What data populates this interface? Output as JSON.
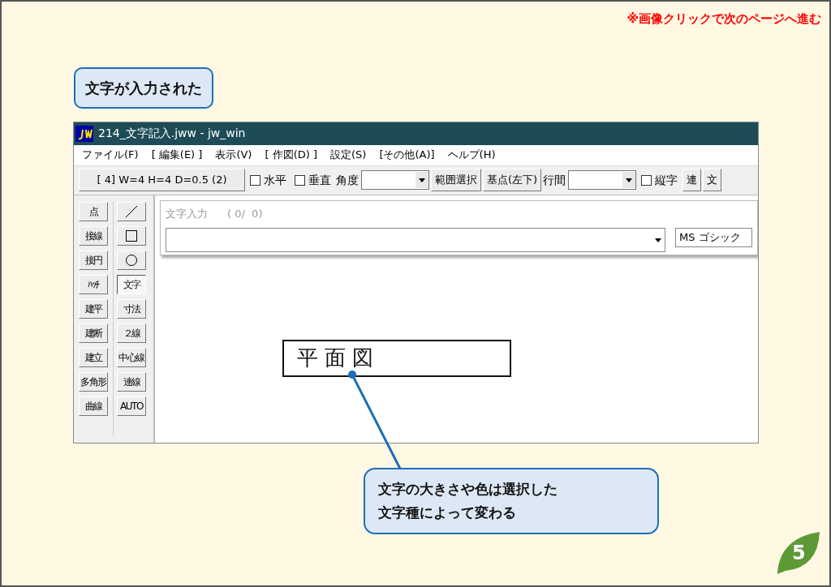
{
  "slide": {
    "notice": "※画像クリックで次のページへ進む",
    "heading": "文字が入力された",
    "page_number": "5"
  },
  "window": {
    "title": "214_文字記入.jww - jw_win"
  },
  "menu": [
    "ファイル(F)",
    "[ 編集(E) ]",
    "表示(V)",
    "[ 作図(D) ]",
    "設定(S)",
    "[その他(A)]",
    "ヘルプ(H)"
  ],
  "toolbar": [
    {
      "kind": "button",
      "label": "[ 4]  W=4  H=4  D=0.5 (2)"
    },
    {
      "kind": "checkbox",
      "label": "水平",
      "checked": false
    },
    {
      "kind": "checkbox",
      "label": "垂直",
      "checked": false
    },
    {
      "kind": "combo",
      "label": "角度"
    },
    {
      "kind": "button",
      "label": "範囲選択"
    },
    {
      "kind": "button",
      "label": "基点(左下)"
    },
    {
      "kind": "combo",
      "label": "行間"
    },
    {
      "kind": "checkbox",
      "label": "縦字",
      "checked": false
    },
    {
      "kind": "button",
      "label": "連"
    },
    {
      "kind": "button",
      "label": "文"
    }
  ],
  "tools_left": [
    {
      "label": "点",
      "selected": false
    },
    {
      "label": "接線",
      "selected": false
    },
    {
      "label": "接円",
      "selected": false
    },
    {
      "label": "ﾊｯﾁ",
      "selected": false
    },
    {
      "label": "建平",
      "selected": false
    },
    {
      "label": "建断",
      "selected": false
    },
    {
      "label": "建立",
      "selected": false
    },
    {
      "label": "多角形",
      "selected": false
    },
    {
      "label": "曲線",
      "selected": false
    }
  ],
  "tools_right": [
    {
      "kind": "line",
      "selected": false
    },
    {
      "kind": "rect",
      "selected": false
    },
    {
      "kind": "circle",
      "selected": false
    },
    {
      "kind": "text",
      "label": "文字",
      "selected": true
    },
    {
      "kind": "text",
      "label": "寸法",
      "selected": false
    },
    {
      "kind": "text",
      "label": "２線",
      "selected": false
    },
    {
      "kind": "text",
      "label": "中心線",
      "selected": false
    },
    {
      "kind": "text",
      "label": "連線",
      "selected": false
    },
    {
      "kind": "text",
      "label": "AUTO",
      "selected": false
    }
  ],
  "text_input": {
    "label": "文字入力",
    "count": "( 0/  0)",
    "font": "MS ゴシック"
  },
  "canvas": {
    "text": "平面図"
  },
  "callout": "文字の大きさや色は選択した文字種によって変わる"
}
